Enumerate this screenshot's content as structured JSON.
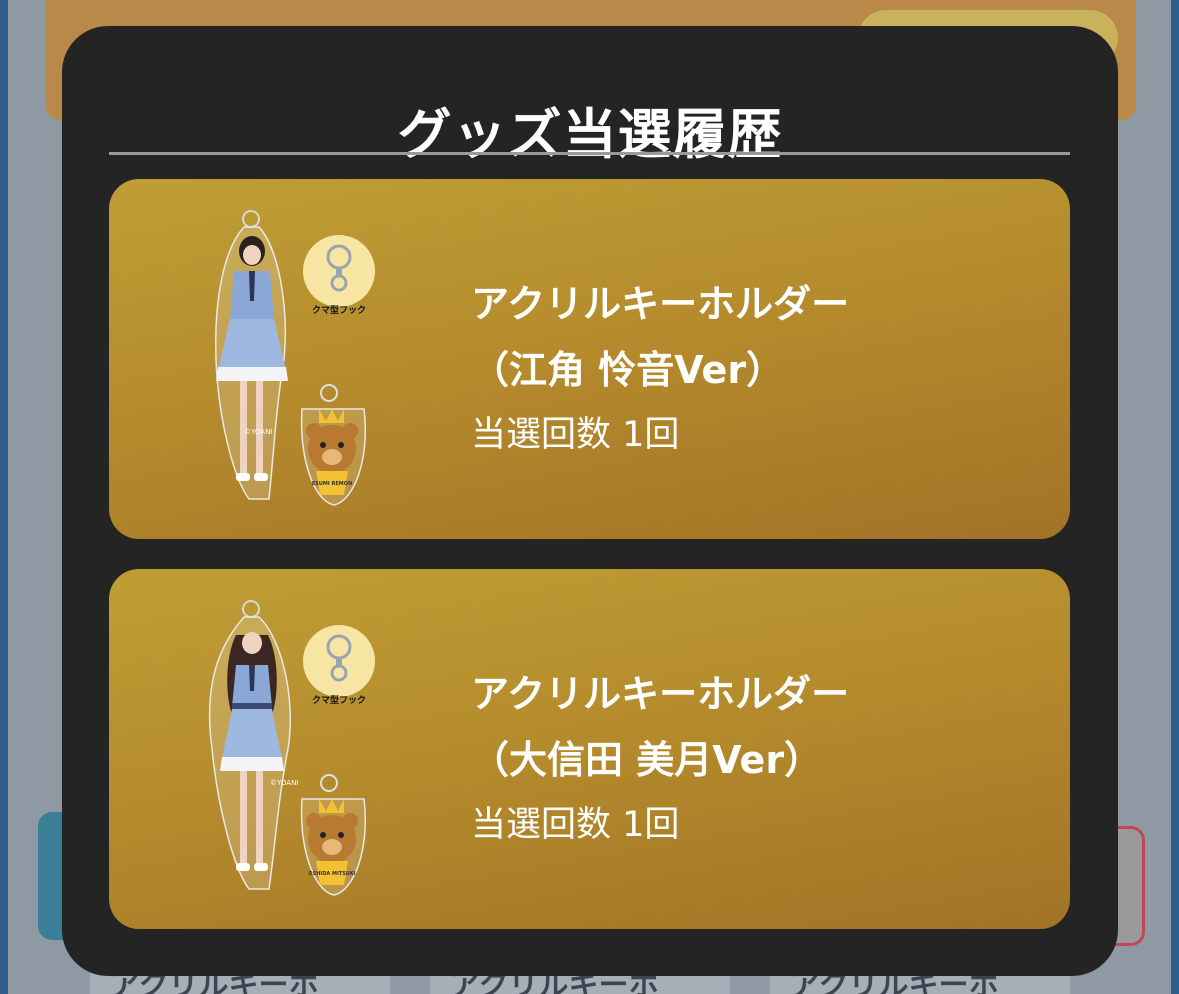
{
  "modal": {
    "title": "グッズ当選履歴"
  },
  "items": [
    {
      "name_line1": "アクリルキーホルダー",
      "name_line2": "（江角 怜音Ver）",
      "win_count": "当選回数 1回",
      "thumb_hook_label": "クマ型フック",
      "thumb_copyright": "©YOANI",
      "thumb_bear_text": "ESUMI REMON"
    },
    {
      "name_line1": "アクリルキーホルダー",
      "name_line2": "（大信田 美月Ver）",
      "win_count": "当選回数 1回",
      "thumb_hook_label": "クマ型フック",
      "thumb_copyright": "©YOANI",
      "thumb_bear_text": "OSHIDA MITSUKI"
    }
  ],
  "background": {
    "bottom_labels": [
      "アクリルキーホ",
      "アクリルキーホ",
      "アクリルキーホ"
    ]
  },
  "colors": {
    "modal_bg": "#242424",
    "card_gold_top": "#c09e35",
    "card_gold_bottom": "#a27326",
    "text": "#ffffff"
  }
}
